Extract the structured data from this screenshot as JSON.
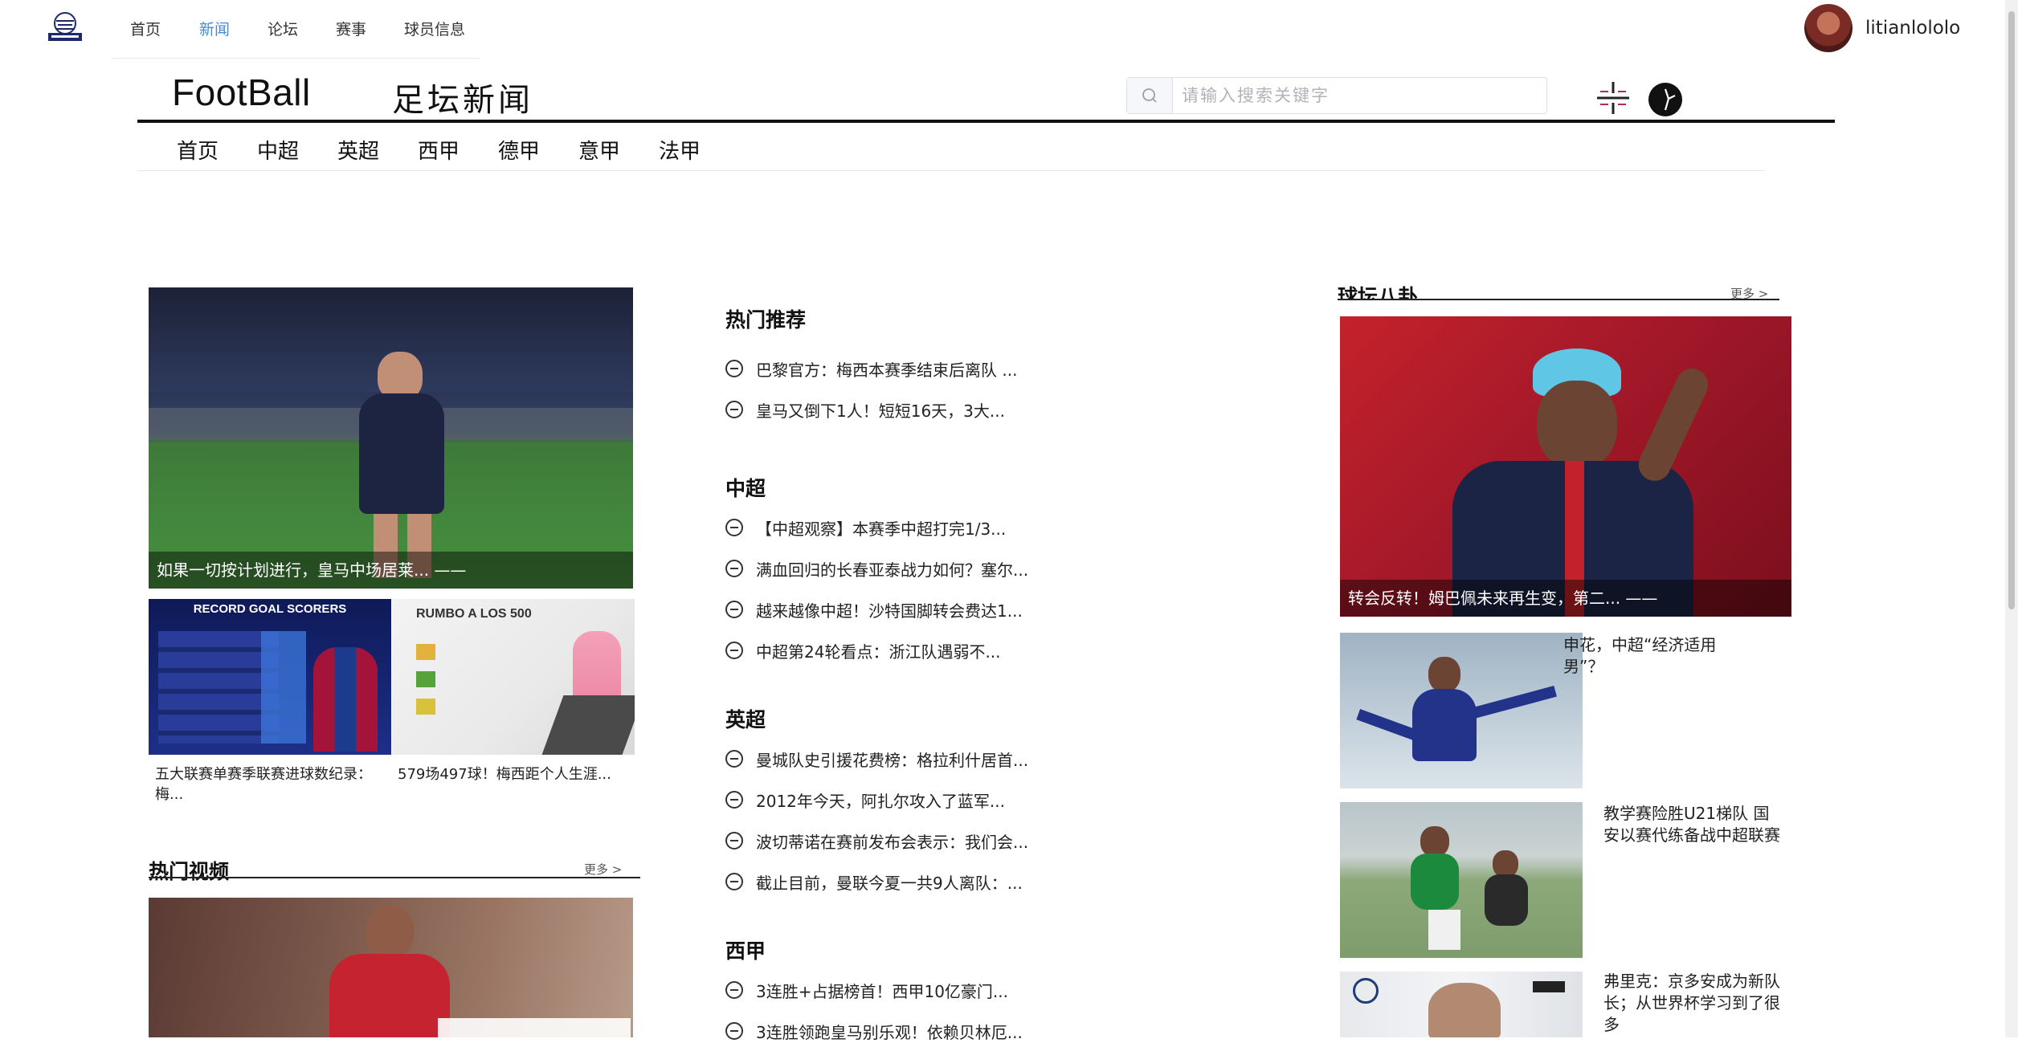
{
  "topnav": {
    "items": [
      {
        "label": "首页"
      },
      {
        "label": "新闻",
        "active": true
      },
      {
        "label": "论坛"
      },
      {
        "label": "赛事"
      },
      {
        "label": "球员信息"
      }
    ]
  },
  "user": {
    "name": "litianlololo"
  },
  "brand": {
    "en": "FootBall",
    "cn": "足坛新闻"
  },
  "search": {
    "placeholder": "请输入搜索关键字",
    "value": ""
  },
  "league_nav": [
    "首页",
    "中超",
    "英超",
    "西甲",
    "德甲",
    "意甲",
    "法甲"
  ],
  "left": {
    "main_caption": "如果一切按计划进行，皇马中场居莱... ——",
    "thumbs": [
      {
        "caption": "五大联赛单赛季联赛进球数纪录：梅...",
        "title": "RECORD GOAL SCORERS"
      },
      {
        "caption": "579场497球！梅西距个人生涯...",
        "title": "RUMBO A LOS 500"
      }
    ],
    "video_section": {
      "title": "热门视频",
      "more": "更多 >"
    }
  },
  "middle": {
    "sections": [
      {
        "title": "热门推荐",
        "items": [
          "巴黎官方：梅西本赛季结束后离队 ...",
          "皇马又倒下1人！短短16天，3大..."
        ]
      },
      {
        "title": "中超",
        "items": [
          "【中超观察】本赛季中超打完1/3...",
          "满血回归的长春亚泰战力如何？塞尔...",
          "越来越像中超！沙特国脚转会费达1...",
          "中超第24轮看点：浙江队遇弱不..."
        ]
      },
      {
        "title": "英超",
        "items": [
          "曼城队史引援花费榜：格拉利什居首...",
          "2012年今天，阿扎尔攻入了蓝军...",
          "波切蒂诺在赛前发布会表示：我们会...",
          "截止目前，曼联今夏一共9人离队：..."
        ]
      },
      {
        "title": "西甲",
        "items": [
          "3连胜+占据榜首！西甲10亿豪门...",
          "3连胜领跑皇马别乐观！依赖贝林厄..."
        ]
      }
    ]
  },
  "right": {
    "title": "球坛八卦",
    "more": "更多 >",
    "big_caption": "转会反转！姆巴佩未来再生变，第二... ——",
    "items": [
      {
        "text": "申花，中超“经济适用男”？"
      },
      {
        "text": "教学赛险胜U21梯队 国安以赛代练备战中超联赛"
      },
      {
        "text": "弗里克：京多安成为新队长；从世界杯学习到了很多"
      }
    ]
  },
  "colors": {
    "accent": "#3a8ee6",
    "rule": "#111111"
  }
}
